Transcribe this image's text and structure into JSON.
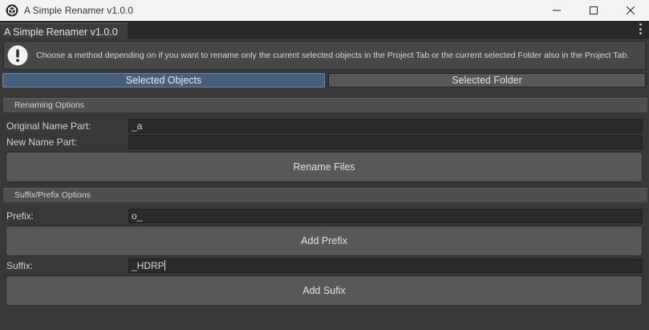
{
  "window": {
    "title": "A Simple Renamer v1.0.0",
    "controls": [
      "minimize",
      "maximize",
      "close"
    ]
  },
  "tab": {
    "label": "A Simple Renamer v1.0.0",
    "menu_icon": "kebab-menu-icon"
  },
  "help": {
    "icon": "info-icon",
    "text": "Choose a method depending on if you want to rename only the current selected objects in the Project Tab or the current selected Folder also in the Project Tab."
  },
  "mode_toggle": {
    "selected": "Selected Objects",
    "options": [
      "Selected Objects",
      "Selected Folder"
    ]
  },
  "renaming": {
    "header": "Renaming Options",
    "original_label": "Original Name Part:",
    "original_value": "_a",
    "new_label": "New Name Part:",
    "new_value": "",
    "button": "Rename Files"
  },
  "affix": {
    "header": "Suffix/Prefix Options",
    "prefix_label": "Prefix:",
    "prefix_value": "o_",
    "prefix_button": "Add Prefix",
    "suffix_label": "Suffix:",
    "suffix_value": "_HDRP",
    "suffix_button": "Add Sufix"
  },
  "colors": {
    "background": "#383838",
    "selected_toggle": "#46607c",
    "button": "#585858",
    "field": "#2a2a2a"
  }
}
